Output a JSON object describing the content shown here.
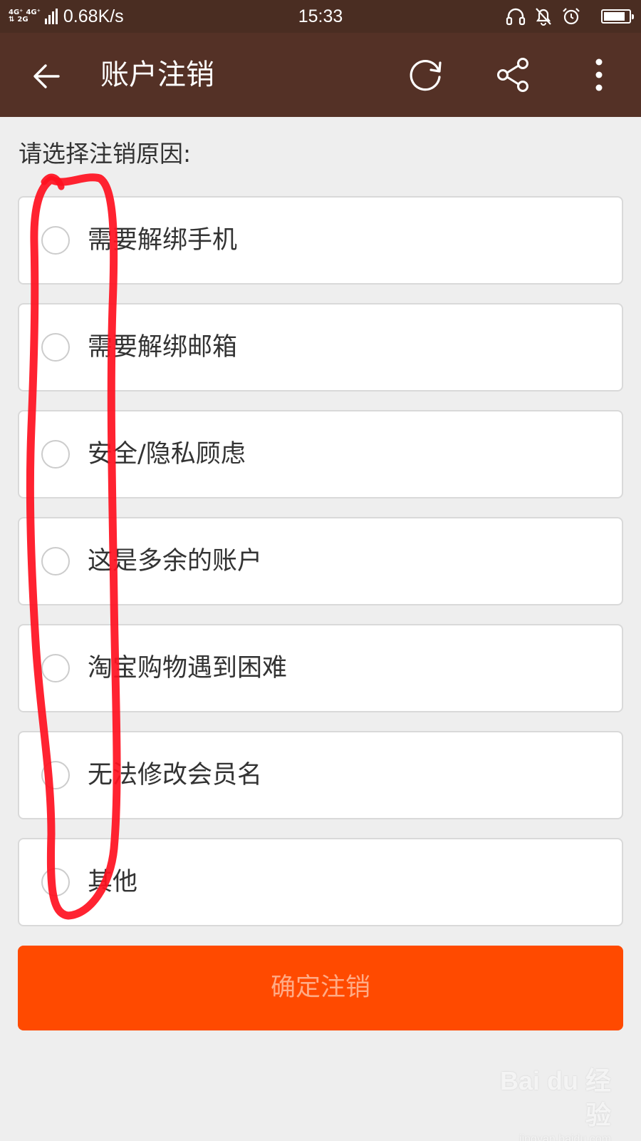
{
  "status_bar": {
    "net_top_1": "4G⁺",
    "net_top_2": "4G⁺",
    "net_bottom_1": "⇅",
    "net_bottom_2": "2G",
    "speed": "0.68K/s",
    "time": "15:33",
    "icons": [
      "headset-icon",
      "bell-muted-icon",
      "alarm-icon",
      "battery-icon"
    ],
    "battery_level": 0.85
  },
  "app_bar": {
    "title": "账户注销",
    "back_icon": "arrow-left-icon",
    "actions": [
      "refresh-icon",
      "share-icon",
      "more-vertical-icon"
    ]
  },
  "form": {
    "prompt": "请选择注销原因:",
    "options": [
      {
        "label": "需要解绑手机",
        "selected": false
      },
      {
        "label": "需要解绑邮箱",
        "selected": false
      },
      {
        "label": "安全/隐私顾虑",
        "selected": false
      },
      {
        "label": "这是多余的账户",
        "selected": false
      },
      {
        "label": "淘宝购物遇到困难",
        "selected": false
      },
      {
        "label": "无法修改会员名",
        "selected": false
      },
      {
        "label": "其他",
        "selected": false
      }
    ],
    "confirm_label": "确定注销"
  },
  "watermark": {
    "main": "Bai du 经验",
    "sub": "jingyan.baidu.com"
  },
  "colors": {
    "status_bar_bg": "#4a2d22",
    "app_bar_bg": "#543126",
    "page_bg": "#eeeeee",
    "confirm_bg": "#ff4a00",
    "confirm_text": "#ffab86",
    "annotation": "#ff1020"
  }
}
